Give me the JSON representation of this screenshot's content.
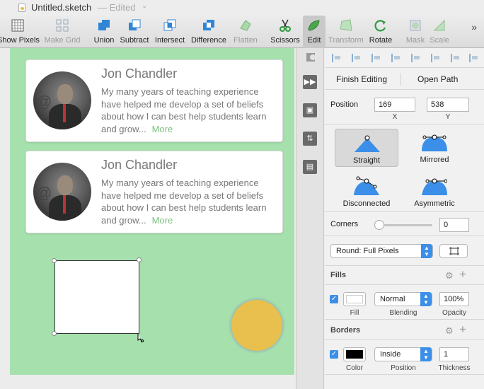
{
  "window": {
    "title": "Untitled.sketch",
    "edited": "— Edited",
    "title_chevron": "⌄"
  },
  "toolbar": {
    "tools": [
      {
        "label": "Show Pixels"
      },
      {
        "label": "Make Grid"
      },
      {
        "label": "Union"
      },
      {
        "label": "Subtract"
      },
      {
        "label": "Intersect"
      },
      {
        "label": "Difference"
      },
      {
        "label": "Flatten"
      },
      {
        "label": "Scissors"
      },
      {
        "label": "Edit"
      },
      {
        "label": "Transform"
      },
      {
        "label": "Rotate"
      },
      {
        "label": "Mask"
      },
      {
        "label": "Scale"
      }
    ],
    "more": "»"
  },
  "cards": [
    {
      "name": "Jon Chandler",
      "bio": "My many years of teaching experience have helped me develop a set of beliefs about how I can best help students learn and grow...",
      "more": "More",
      "avatar_text": "@"
    },
    {
      "name": "Jon Chandler",
      "bio": "My many years of teaching experience have helped me develop a set of beliefs about how I can best help students learn and grow...",
      "more": "More",
      "avatar_text": "@"
    }
  ],
  "colors": {
    "artboard": "#a6e1ad",
    "circle": "#e9bf4d",
    "accent": "#3b8fe8",
    "link": "#7bc27f"
  },
  "inspector": {
    "finish_editing": "Finish Editing",
    "open_path": "Open Path",
    "position": {
      "label": "Position",
      "x": "169",
      "y": "538",
      "x_label": "X",
      "y_label": "Y"
    },
    "point_types": [
      "Straight",
      "Mirrored",
      "Disconnected",
      "Asymmetric"
    ],
    "corners": {
      "label": "Corners",
      "value": "0"
    },
    "rounding": {
      "value": "Round: Full Pixels"
    },
    "fills": {
      "title": "Fills",
      "fill_label": "Fill",
      "blending": "Normal",
      "blending_label": "Blending",
      "opacity": "100%",
      "opacity_label": "Opacity",
      "fill_color": "#ffffff"
    },
    "borders": {
      "title": "Borders",
      "color_label": "Color",
      "position": "Inside",
      "position_label": "Position",
      "thickness": "1",
      "thickness_label": "Thickness",
      "border_color": "#000000"
    }
  }
}
